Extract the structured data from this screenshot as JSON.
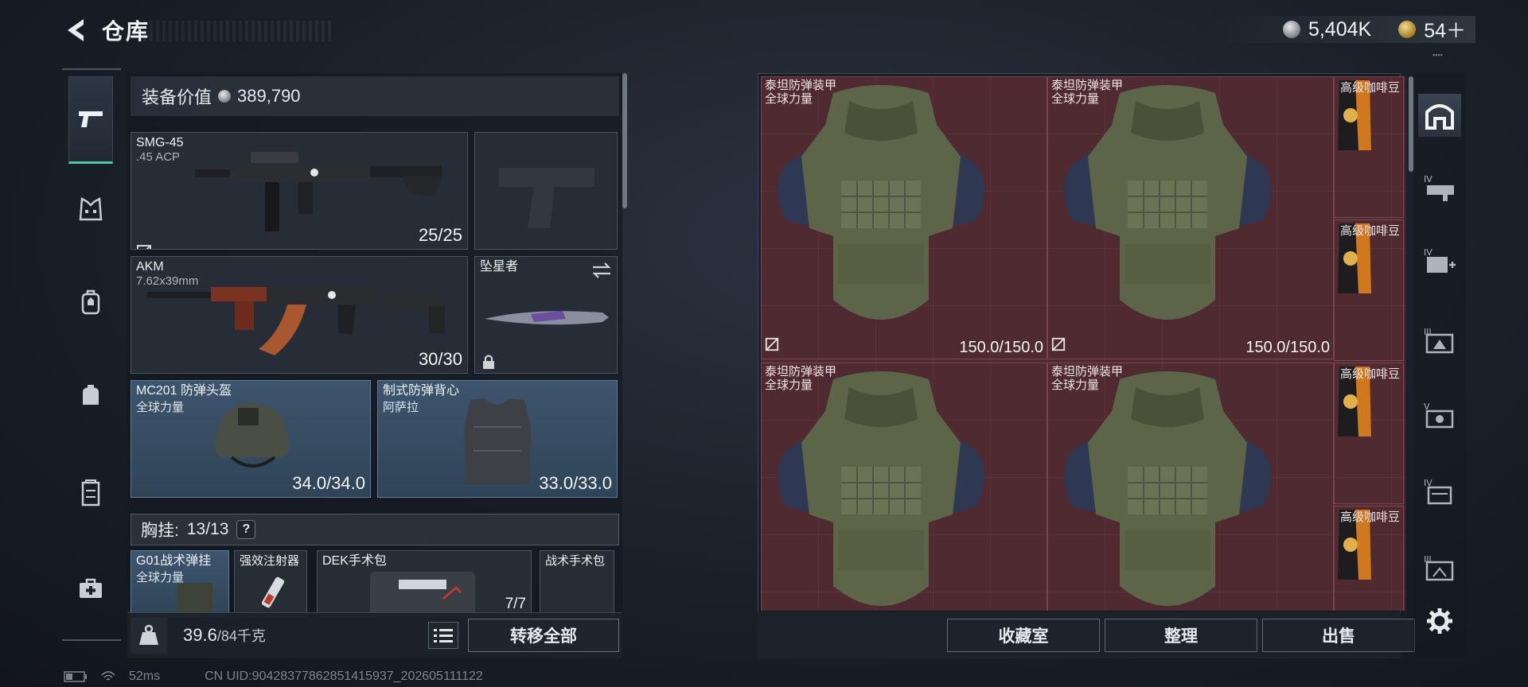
{
  "header": {
    "title": "仓库",
    "currency_silver": "5,404K",
    "currency_gold": "54＋"
  },
  "left_nav": {
    "items": [
      "pistol-icon",
      "vest-icon",
      "backpack-icon",
      "bag-icon",
      "locker-icon",
      "medkit-icon"
    ]
  },
  "equipment": {
    "value_label": "装备价值",
    "value": "389,790",
    "primary_weapon": {
      "name": "SMG-45",
      "ammo": ".45 ACP",
      "durability": "25/25"
    },
    "secondary_weapon": {
      "name": "AKM",
      "ammo": "7.62x39mm",
      "durability": "30/30"
    },
    "melee": {
      "name": "坠星者"
    },
    "helmet": {
      "name": "MC201 防弹头盔",
      "brand": "全球力量",
      "durability": "34.0/34.0"
    },
    "vest": {
      "name": "制式防弹背心",
      "brand": "阿萨拉",
      "durability": "33.0/33.0"
    },
    "chest_rig_label": "胸挂:",
    "chest_rig_count": "13/13",
    "chest_items": [
      {
        "name": "G01战术弹挂",
        "brand": "全球力量"
      },
      {
        "name": "强效注射器"
      },
      {
        "name": "DEK手术包",
        "count": "7/7"
      },
      {
        "name": "战术手术包"
      }
    ],
    "weight": "39.6",
    "weight_max": "/84千克",
    "transfer_all": "转移全部"
  },
  "storage": {
    "armor_items": [
      {
        "name": "泰坦防弹装甲",
        "brand": "全球力量",
        "durability": "150.0/150.0"
      },
      {
        "name": "泰坦防弹装甲",
        "brand": "全球力量",
        "durability": "150.0/150.0"
      },
      {
        "name": "泰坦防弹装甲",
        "brand": "全球力量",
        "durability": ""
      },
      {
        "name": "泰坦防弹装甲",
        "brand": "全球力量",
        "durability": ""
      }
    ],
    "coffee_items": [
      "高级咖啡豆",
      "高级咖啡豆",
      "高级咖啡豆",
      "高级咖啡豆"
    ],
    "buttons": {
      "collection": "收藏室",
      "organize": "整理",
      "sell": "出售"
    }
  },
  "right_nav": {
    "tier_labels": [
      "IV",
      "IV",
      "III",
      "V",
      "IV",
      "III"
    ]
  },
  "status": {
    "ping": "52ms",
    "uid": "CN UID:904283778628514159​37_202605111122"
  },
  "colors": {
    "accent_teal": "#49c6a8",
    "grid_bg": "#4f2a31",
    "slot_blue": "#3d556d"
  }
}
